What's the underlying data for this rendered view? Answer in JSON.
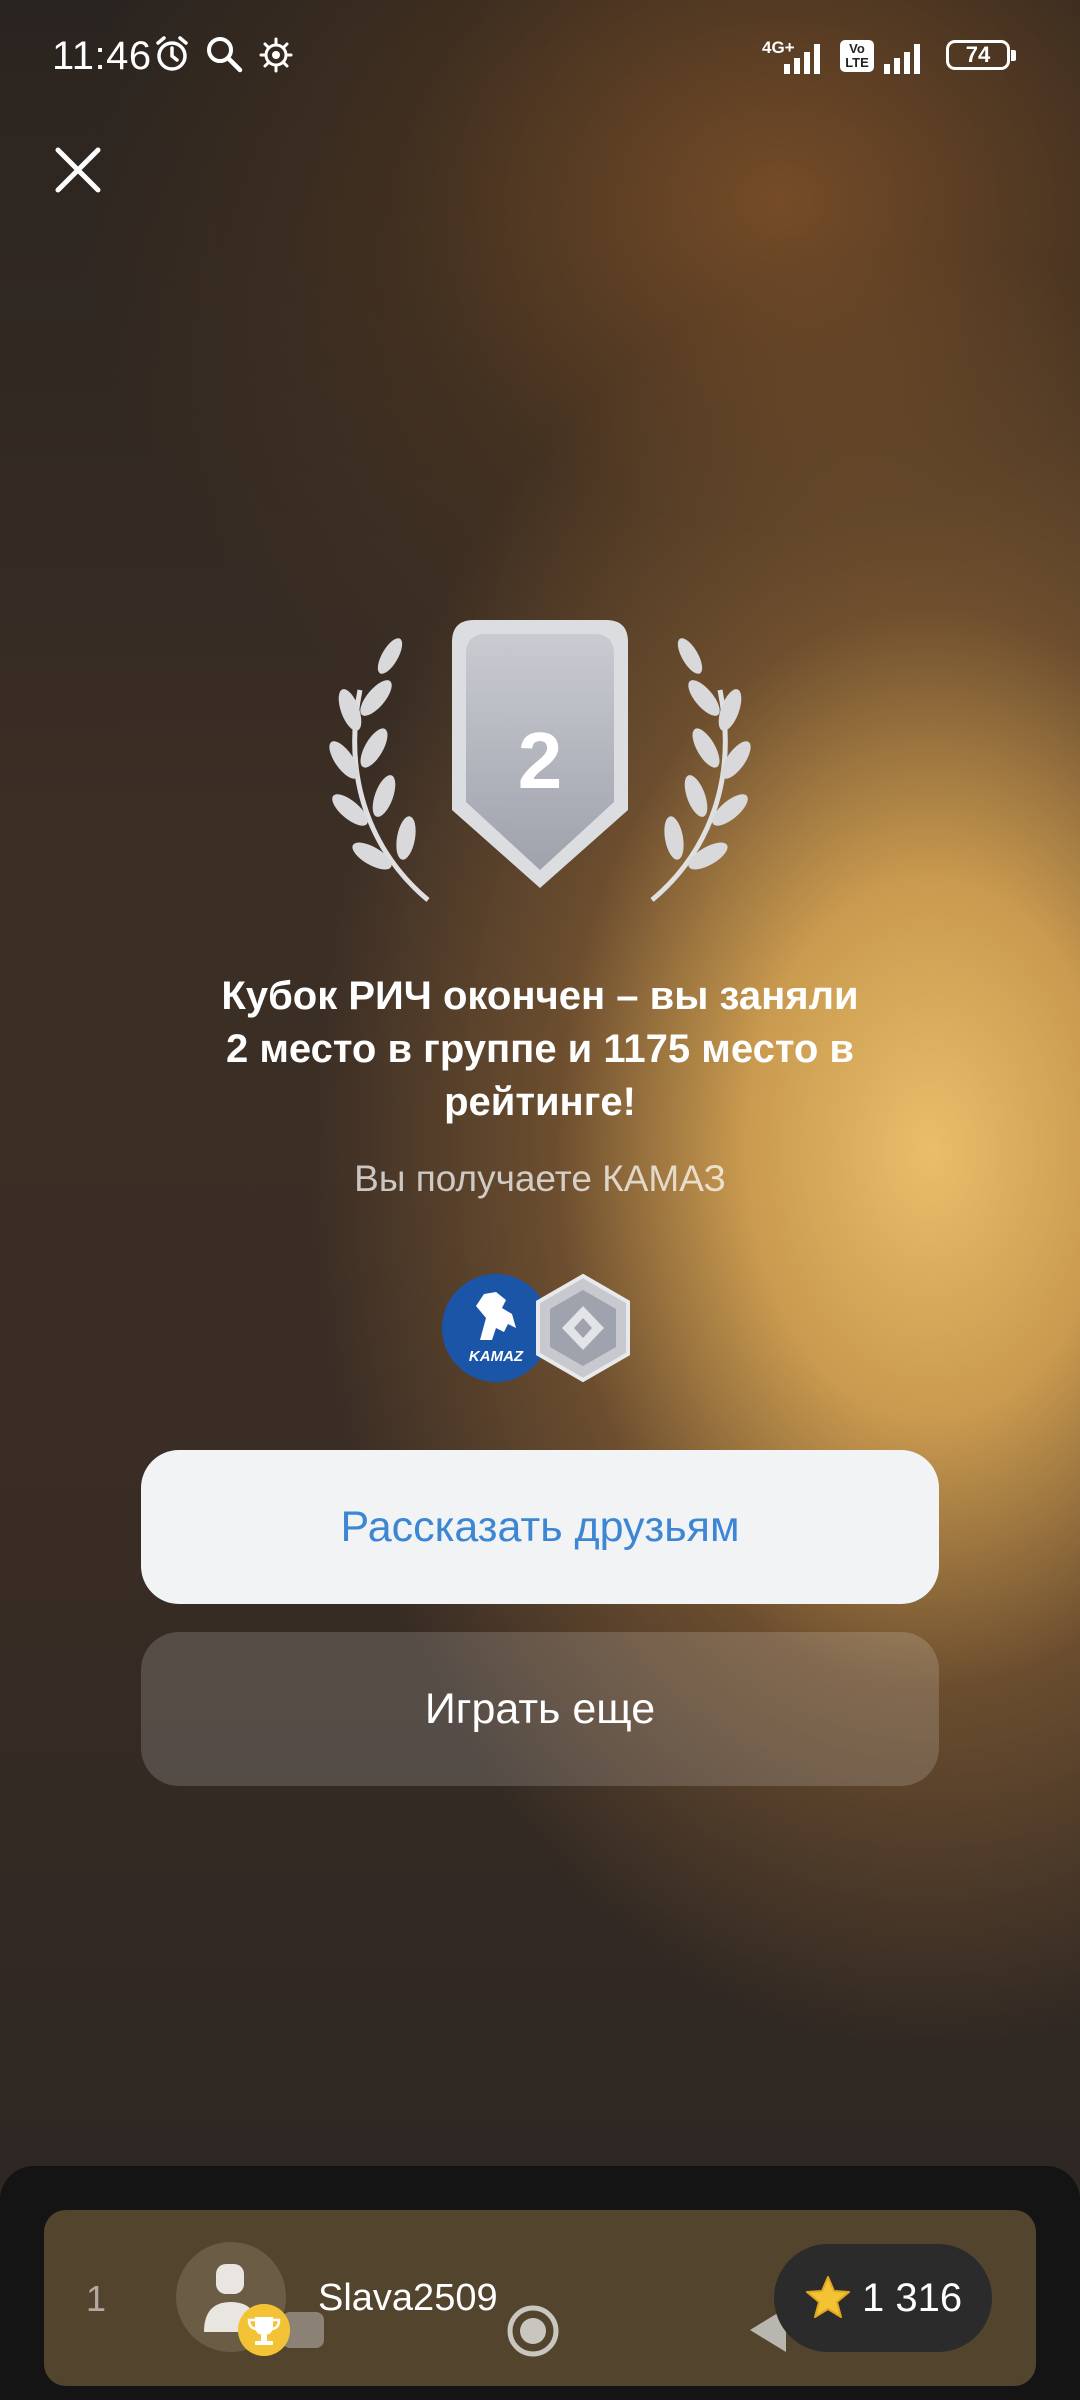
{
  "status_bar": {
    "time": "11:46",
    "network_label": "4G+",
    "volte_label": "Vo LTE",
    "battery": "74"
  },
  "badge": {
    "place": "2"
  },
  "result": {
    "headline_line1": "Кубок РИЧ окончен – вы заняли",
    "headline_line2": "2 место в группе и 1175 место в",
    "headline_line3": "рейтинге!",
    "reward_text": "Вы получаете КАМАЗ",
    "reward_logo_text": "KAMAZ"
  },
  "buttons": {
    "share": "Рассказать друзьям",
    "play_again": "Играть еще"
  },
  "player": {
    "rank": "1",
    "username": "Slava2509",
    "score": "1 316"
  },
  "colors": {
    "share_text": "#3c86d3",
    "trophy": "#f4c235",
    "kamaz_blue": "#1a55a8"
  }
}
